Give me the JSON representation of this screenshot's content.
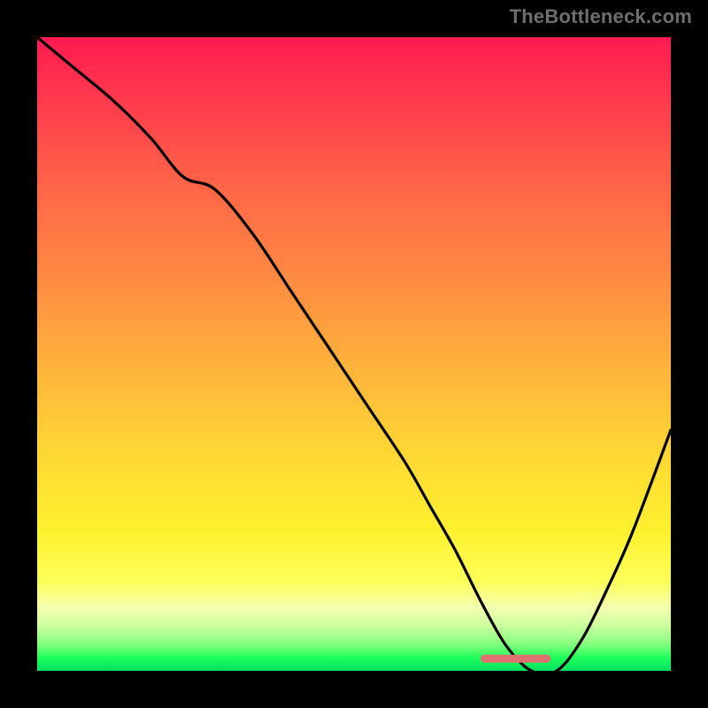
{
  "watermark": "TheBottleneck.com",
  "chart_data": {
    "type": "line",
    "title": "",
    "xlabel": "",
    "ylabel": "",
    "xlim": [
      0,
      100
    ],
    "ylim": [
      0,
      100
    ],
    "grid": false,
    "series": [
      {
        "name": "bottleneck-curve",
        "color": "#000000",
        "x": [
          0,
          6,
          12,
          18,
          23,
          28,
          34,
          40,
          46,
          52,
          58,
          62,
          66,
          70,
          74,
          78,
          82,
          86,
          90,
          94,
          100
        ],
        "values": [
          100,
          95,
          90,
          84,
          78,
          76,
          69,
          60,
          51,
          42,
          33,
          26,
          19,
          11,
          4,
          0,
          0,
          5,
          13,
          22,
          38
        ]
      }
    ],
    "marker": {
      "name": "optimal-range",
      "color": "#e07070",
      "x_start": 70,
      "x_end": 81,
      "y": 2
    },
    "background_gradient": {
      "top": "#ff1a52",
      "middle": "#ffd834",
      "bottom": "#03e060"
    }
  }
}
